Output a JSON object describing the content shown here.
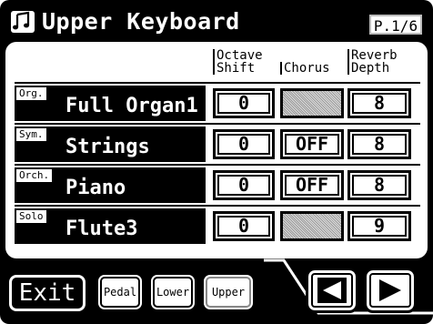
{
  "header": {
    "title": "Upper Keyboard",
    "page_indicator": "P.1/6",
    "icon": "music-notes-icon"
  },
  "columns": {
    "octave_shift": "Octave\nShift",
    "chorus": "Chorus",
    "reverb_depth": "Reverb\nDepth"
  },
  "rows": [
    {
      "category": "Org.",
      "tone": "Full Organ1",
      "octave_shift": "0",
      "chorus": "",
      "reverb": "8"
    },
    {
      "category": "Sym.",
      "tone": "Strings",
      "octave_shift": "0",
      "chorus": "OFF",
      "reverb": "8"
    },
    {
      "category": "Orch.",
      "tone": "Piano",
      "octave_shift": "0",
      "chorus": "OFF",
      "reverb": "8"
    },
    {
      "category": "Solo",
      "tone": "Flute3",
      "octave_shift": "0",
      "chorus": "",
      "reverb": "9"
    }
  ],
  "footer": {
    "exit_label": "Exit",
    "part_buttons": [
      "Pedal",
      "Lower",
      "Upper"
    ],
    "active_part": "Upper",
    "prev_icon": "triangle-left-icon",
    "next_icon": "triangle-right-icon"
  }
}
